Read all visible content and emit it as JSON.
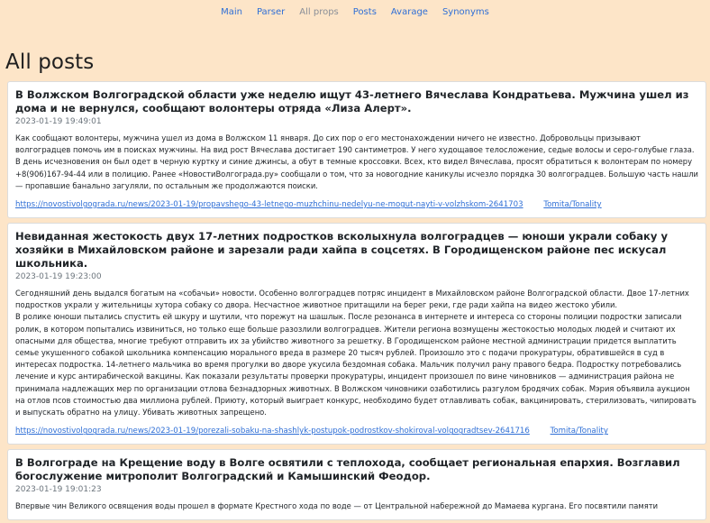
{
  "nav": {
    "items": [
      {
        "label": "Main",
        "active": false
      },
      {
        "label": "Parser",
        "active": false
      },
      {
        "label": "All props",
        "active": true
      },
      {
        "label": "Posts",
        "active": false
      },
      {
        "label": "Avarage",
        "active": false
      },
      {
        "label": "Synonyms",
        "active": false
      }
    ]
  },
  "page": {
    "title": "All posts"
  },
  "posts": [
    {
      "title": "В Волжском Волгоградской области уже неделю ищут 43-летнего Вячеслава Кондратьева. Мужчина ушел из дома и не вернулся, сообщают волонтеры отряда «Лиза Алерт».",
      "date": "2023-01-19 19:49:01",
      "text": "Как сообщают волонтеры, мужчина ушел из дома в Волжском 11 января. До сих пор о его местонахождении ничего не известно. Добровольцы призывают волгоградцев помочь им в поисках мужчины. На вид рост Вячеслава достигает 190 сантиметров. У него худощавое телосложение, седые волосы и серо-голубые глаза. В день исчезновения он был одет в черную куртку и синие джинсы, а обут в темные кроссовки.  Всех, кто видел Вячеслава, просят обратиться к волонтерам по номеру +8(906)167-94-44 или в полицию.  Ранее «НовостиВолгограда.ру» сообщали о том, что за новогодние каникулы исчезло порядка 30 волгоградцев. Большую часть нашли — пропавшие банально загуляли, по остальным же продолжаются поиски.",
      "url": "https://novostivolgograda.ru/news/2023-01-19/propavshego-43-letnego-muzhchinu-nedelyu-ne-mogut-nayti-v-volzhskom-2641703",
      "tonality_label": "Tomita/Tonality"
    },
    {
      "title": "Невиданная жестокость двух 17-летних подростков всколыхнула волгоградцев — юноши украли собаку у хозяйки в Михайловском районе и зарезали ради хайпа в соцсетях. В Городищенском районе пес искусал школьника.",
      "date": "2023-01-19 19:23:00",
      "text": "Сегодняшний день выдался богатым на «собачьи» новости. Особенно волгоградцев потряс инцидент в Михайловском районе Волгоградской области. Двое 17-летних подростков украли у жительницы хутора собаку со двора. Несчастное животное притащили на берег реки, где ради хайпа на видео жестоко убили.\nВ ролике юноши пытались спустить ей шкуру и шутили, что порежут на шашлык. После резонанса в интернете и интереса со стороны полиции подростки записали ролик, в котором попытались извиниться, но только еще больше разозлили волгоградцев. Жители региона возмущены жестокостью молодых людей и считают их опасными для общества, многие требуют отправить их за убийство животного за решетку. В Городищенском районе местной администрации придется выплатить семье укушенного собакой школьника компенсацию морального вреда в размере 20 тысяч рублей. Произошло это с подачи прокуратуры, обратившейся в суд в интересах подростка. 14-летнего мальчика во время прогулки во дворе укусила бездомная собака. Мальчик получил рану правого бедра. Подростку потребовались лечение и курс антирабической вакцины. Как показали результаты проверки прокуратуры, инцидент произошел по вине чиновников — администрация района не принимала надлежащих мер по организации отлова безнадзорных животных. В Волжском чиновники озаботились разгулом бродячих собак. Мэрия объявила аукцион на отлов псов стоимостью два миллиона рублей. Приюту, который выиграет конкурс, необходимо будет отлавливать собак, вакцинировать, стерилизовать, чипировать и выпускать обратно на улицу.  Убивать животных запрещено.",
      "url": "https://novostivolgograda.ru/news/2023-01-19/porezali-sobaku-na-shashlyk-postupok-podrostkov-shokiroval-volgogradtsev-2641716",
      "tonality_label": "Tomita/Tonality"
    },
    {
      "title": "В Волгограде на Крещение воду в Волге освятили с теплохода, сообщает региональная епархия. Возглавил богослужение митрополит Волгоградский и Камышинский Феодор.",
      "date": "2023-01-19 19:01:23",
      "text": "Впервые чин Великого освящения воды прошел в формате Крестного хода по воде — от Центральной набережной до Мамаева кургана. Его посвятили памяти",
      "url": "",
      "tonality_label": ""
    }
  ]
}
